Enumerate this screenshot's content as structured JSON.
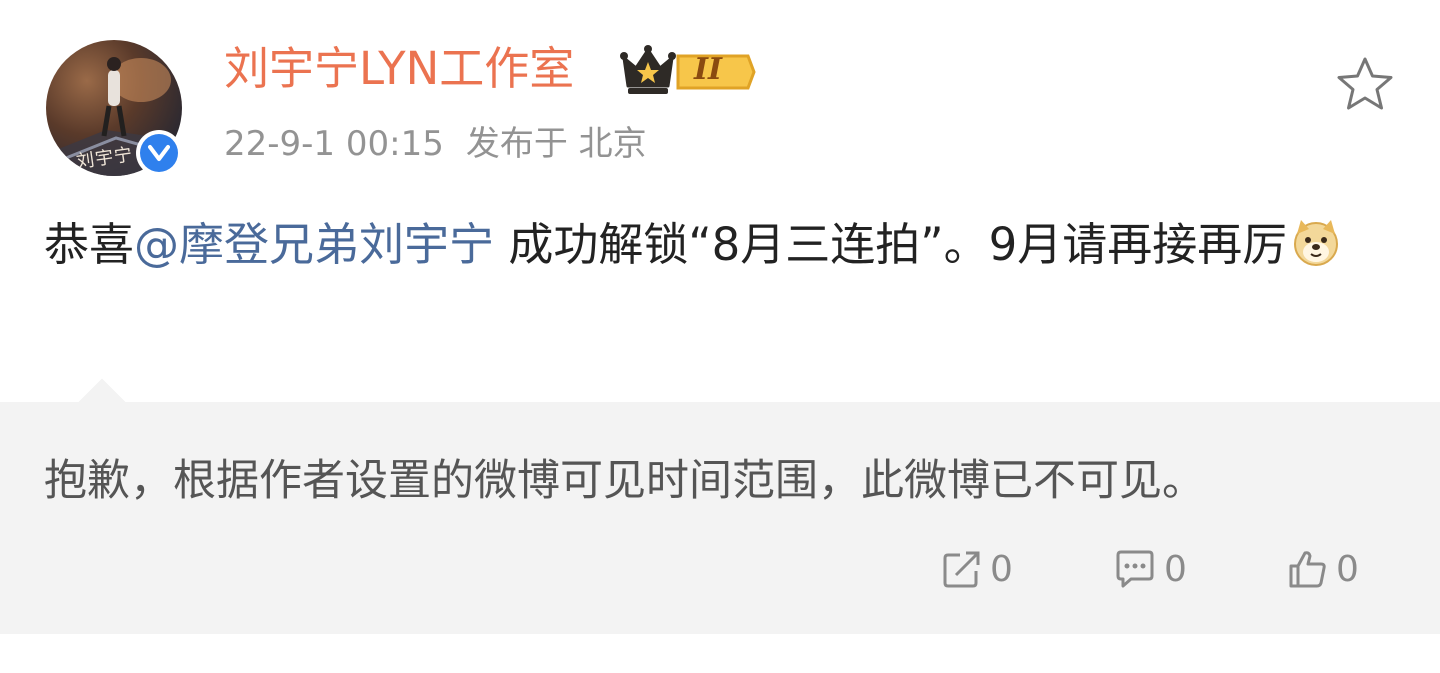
{
  "post": {
    "author": {
      "name": "刘宇宁LYN工作室",
      "badge_level": "II",
      "avatar_caption": "刘宇宁"
    },
    "timestamp": "22-9-1 00:15",
    "location": "发布于 北京",
    "content": {
      "prefix": "恭喜",
      "mention": "@摩登兄弟刘宇宁",
      "suffix": " 成功解锁“8月三连拍”。9月请再接再厉"
    },
    "notice": "抱歉，根据作者设置的微博可见时间范围，此微博已不可见。",
    "actions": {
      "repost_count": "0",
      "comment_count": "0",
      "like_count": "0"
    }
  },
  "colors": {
    "username": "#eb7350",
    "mention": "#4a6a9a",
    "meta": "#939393",
    "panel_bg": "#f3f3f3",
    "verified": "#2f80ed"
  }
}
